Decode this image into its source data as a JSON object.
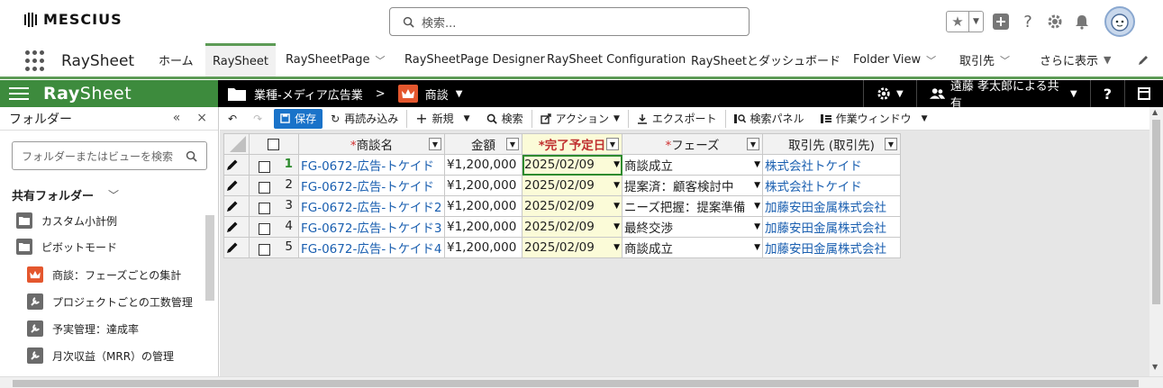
{
  "header": {
    "logo_text": "MESCIUS",
    "search_placeholder": "検索..."
  },
  "nav": {
    "app_name": "RaySheet",
    "tabs": [
      {
        "label": "ホーム"
      },
      {
        "label": "RaySheet",
        "active": true
      },
      {
        "label": "RaySheetPage"
      },
      {
        "label": "RaySheetPage Designer"
      },
      {
        "label": "RaySheet Configuration"
      },
      {
        "label": "RaySheetとダッシュボード"
      },
      {
        "label": "Folder View"
      },
      {
        "label": "取引先"
      },
      {
        "label": "さらに表示"
      }
    ]
  },
  "rs_bar": {
    "logo_bold": "Ray",
    "logo_light": "Sheet",
    "breadcrumb_folder": "業種-メディア広告業",
    "breadcrumb_sep": ">",
    "breadcrumb_view": "商談",
    "share_label": "遠藤 孝太郎による共有",
    "help": "?"
  },
  "left_panel": {
    "title": "フォルダー",
    "collapse": "«",
    "close": "×",
    "search_placeholder": "フォルダーまたはビューを検索",
    "shared_heading": "共有フォルダー",
    "items": [
      {
        "label": "カスタム小計例",
        "icon": "folder-icon"
      },
      {
        "label": "ピボットモード",
        "icon": "folder-icon"
      },
      {
        "label": "商談：フェーズごとの集計",
        "icon": "crown-icon"
      },
      {
        "label": "プロジェクトごとの工数管理",
        "icon": "wrench-icon"
      },
      {
        "label": "予実管理：達成率",
        "icon": "wrench-icon"
      },
      {
        "label": "月次収益（MRR）の管理",
        "icon": "wrench-icon"
      }
    ]
  },
  "toolbar": {
    "save": "保存",
    "reload": "再読み込み",
    "new": "新規",
    "search": "検索",
    "action": "アクション",
    "export": "エクスポート",
    "search_panel": "検索パネル",
    "work_window": "作業ウィンドウ"
  },
  "grid": {
    "columns": {
      "name": "商談名",
      "amount": "金額",
      "close_date": "完了予定日",
      "phase": "フェーズ",
      "account": "取引先 (取引先)"
    },
    "rows": [
      {
        "num": "1",
        "name": "FG-0672-広告-トケイド",
        "amount": "¥1,200,000",
        "close_date": "2025/02/09",
        "phase": "商談成立",
        "account": "株式会社トケイド"
      },
      {
        "num": "2",
        "name": "FG-0672-広告-トケイド",
        "amount": "¥1,200,000",
        "close_date": "2025/02/09",
        "phase": "提案済：顧客検討中",
        "account": "株式会社トケイド"
      },
      {
        "num": "3",
        "name": "FG-0672-広告-トケイド2",
        "amount": "¥1,200,000",
        "close_date": "2025/02/09",
        "phase": "ニーズ把握：提案準備",
        "account": "加藤安田金属株式会社"
      },
      {
        "num": "4",
        "name": "FG-0672-広告-トケイド3",
        "amount": "¥1,200,000",
        "close_date": "2025/02/09",
        "phase": "最終交渉",
        "account": "加藤安田金属株式会社"
      },
      {
        "num": "5",
        "name": "FG-0672-広告-トケイド4",
        "amount": "¥1,200,000",
        "close_date": "2025/02/09",
        "phase": "商談成立",
        "account": "加藤安田金属株式会社"
      }
    ]
  },
  "colors": {
    "accent_green": "#3d8b3d",
    "save_blue": "#1a73c9",
    "link_blue": "#1a5fb0",
    "crown_orange": "#e4572e"
  }
}
